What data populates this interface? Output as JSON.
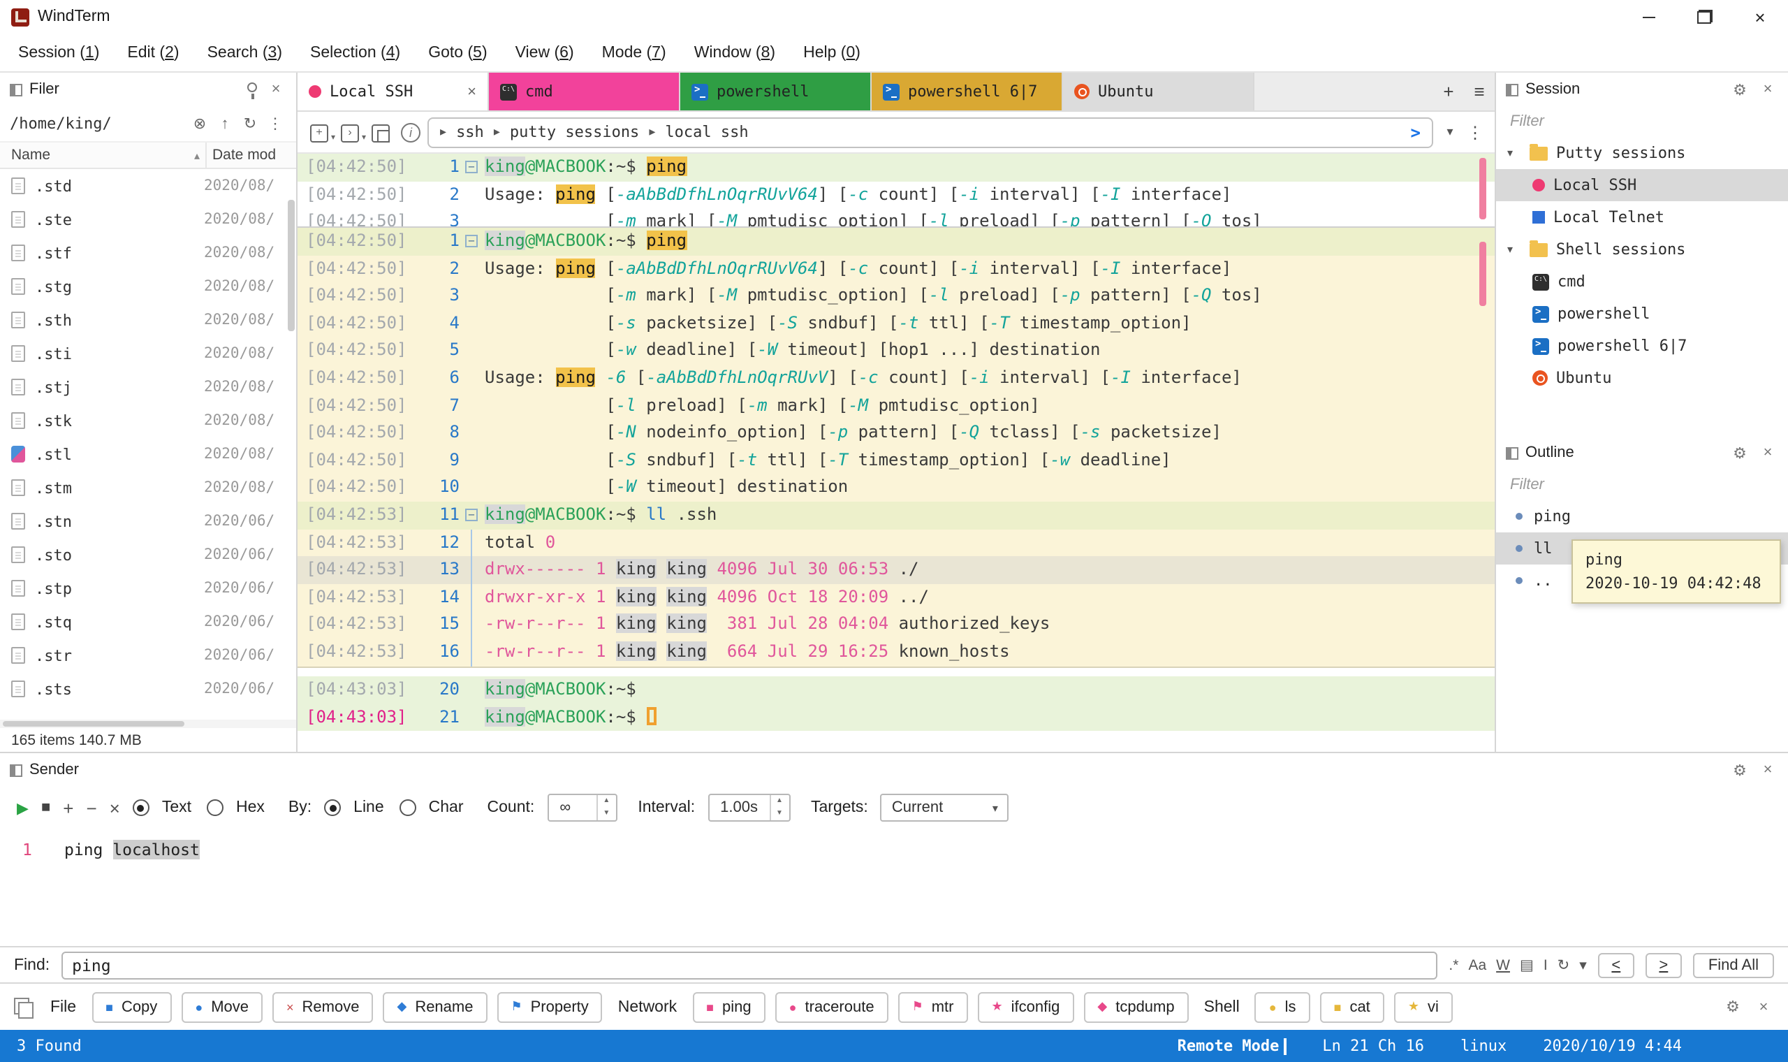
{
  "window": {
    "title": "WindTerm"
  },
  "menu": [
    "Session (1)",
    "Edit (2)",
    "Search (3)",
    "Selection (4)",
    "Goto (5)",
    "View (6)",
    "Mode (7)",
    "Window (8)",
    "Help (0)"
  ],
  "icons": {
    "play": "▶",
    "stop": "■",
    "plus": "+",
    "minus": "−",
    "cross": "×",
    "up_arrow": "▲",
    "down_arrow": "▼",
    "caret_down": "▾",
    "breadcrumb_arrow": "▸",
    "more_vertical": "⋮",
    "menu": "≡",
    "gear": "⚙",
    "sort_asc": "▴",
    "send_arrow": ">",
    "refresh": "↻",
    "clear": "⊗",
    "up_dir": "↑",
    "square": "■",
    "circle": "●",
    "diamond": "◆",
    "flag": "⚑",
    "star": "★"
  },
  "filer": {
    "title": "Filer",
    "path": "/home/king/",
    "name_column": "Name",
    "date_column": "Date mod",
    "files": [
      {
        "name": ".std",
        "date": "2020/08/"
      },
      {
        "name": ".ste",
        "date": "2020/08/"
      },
      {
        "name": ".stf",
        "date": "2020/08/"
      },
      {
        "name": ".stg",
        "date": "2020/08/"
      },
      {
        "name": ".sth",
        "date": "2020/08/"
      },
      {
        "name": ".sti",
        "date": "2020/08/"
      },
      {
        "name": ".stj",
        "date": "2020/08/"
      },
      {
        "name": ".stk",
        "date": "2020/08/"
      },
      {
        "name": ".stl",
        "date": "2020/08/",
        "special": true
      },
      {
        "name": ".stm",
        "date": "2020/08/"
      },
      {
        "name": ".stn",
        "date": "2020/06/"
      },
      {
        "name": ".sto",
        "date": "2020/06/"
      },
      {
        "name": ".stp",
        "date": "2020/06/"
      },
      {
        "name": ".stq",
        "date": "2020/06/"
      },
      {
        "name": ".str",
        "date": "2020/06/"
      },
      {
        "name": ".sts",
        "date": "2020/06/"
      }
    ],
    "status": "165 items 140.7 MB"
  },
  "tabs": [
    {
      "label": "Local SSH",
      "icon": "ssh",
      "active": true
    },
    {
      "label": "cmd",
      "icon": "cmd",
      "color": "pink"
    },
    {
      "label": "powershell",
      "icon": "powershell",
      "color": "green"
    },
    {
      "label": "powershell 6|7",
      "icon": "powershell",
      "color": "yellow"
    },
    {
      "label": "Ubuntu",
      "icon": "ubuntu",
      "color": "grey"
    }
  ],
  "address": {
    "crumbs": [
      "ssh",
      "putty sessions",
      "local ssh"
    ]
  },
  "terminal": {
    "buffer": [
      {
        "ts": "[04:42:50]",
        "n": "1",
        "fold": true,
        "cmd": true,
        "s": [
          [
            "king",
            "kg"
          ],
          [
            "@MACBOOK",
            "g"
          ],
          [
            ":~$ ",
            "d"
          ],
          [
            "ping",
            "m"
          ]
        ]
      },
      {
        "ts": "[04:42:50]",
        "n": "2",
        "s": [
          [
            "Usage: ",
            "d"
          ],
          [
            "ping",
            "m"
          ],
          [
            " [",
            "d"
          ],
          [
            "-aAbBdDfhLnOqrRUvV64",
            "o"
          ],
          [
            "] [",
            "d"
          ],
          [
            "-c",
            "o"
          ],
          [
            " count] [",
            "d"
          ],
          [
            "-i",
            "o"
          ],
          [
            " interval] [",
            "d"
          ],
          [
            "-I",
            "o"
          ],
          [
            " interface]",
            "d"
          ]
        ]
      },
      {
        "ts": "[04:42:50]",
        "n": "3",
        "s": [
          [
            "            [",
            "d"
          ],
          [
            "-m",
            "o"
          ],
          [
            " mark] [",
            "d"
          ],
          [
            "-M",
            "o"
          ],
          [
            " pmtudisc_option] [",
            "d"
          ],
          [
            "-l",
            "o"
          ],
          [
            " preload] [",
            "d"
          ],
          [
            "-p",
            "o"
          ],
          [
            " pattern] [",
            "d"
          ],
          [
            "-Q",
            "o"
          ],
          [
            " tos]",
            "d"
          ]
        ]
      },
      {
        "ts": "[04:42:50]",
        "n": "4",
        "s": [
          [
            "            [",
            "d"
          ],
          [
            "-s",
            "o"
          ],
          [
            " packetsize] [",
            "d"
          ],
          [
            "-S",
            "o"
          ],
          [
            " sndbuf] [",
            "d"
          ],
          [
            "-t",
            "o"
          ],
          [
            " ttl] [",
            "d"
          ],
          [
            "-T",
            "o"
          ],
          [
            " timestamp_option]",
            "d"
          ]
        ]
      },
      {
        "ts": "[04:42:50]",
        "n": "5",
        "s": [
          [
            "            [",
            "d"
          ],
          [
            "-w",
            "o"
          ],
          [
            " deadline] [",
            "d"
          ],
          [
            "-W",
            "o"
          ],
          [
            " timeout] [hop1 ...] destination",
            "d"
          ]
        ]
      },
      {
        "ts": "[04:42:50]",
        "n": "6",
        "s": [
          [
            "Usage: ",
            "d"
          ],
          [
            "ping",
            "m"
          ],
          [
            " ",
            "d"
          ],
          [
            "-6",
            "o"
          ],
          [
            " [",
            "d"
          ],
          [
            "-aAbBdDfhLnOqrRUvV",
            "o"
          ],
          [
            "] [",
            "d"
          ],
          [
            "-c",
            "o"
          ],
          [
            " count] [",
            "d"
          ],
          [
            "-i",
            "o"
          ],
          [
            " interval] [",
            "d"
          ],
          [
            "-I",
            "o"
          ],
          [
            " interface]",
            "d"
          ]
        ]
      },
      {
        "ts": "[04:42:50]",
        "n": "7",
        "s": [
          [
            "            [",
            "d"
          ],
          [
            "-l",
            "o"
          ],
          [
            " preload] [",
            "d"
          ],
          [
            "-m",
            "o"
          ],
          [
            " mark] [",
            "d"
          ],
          [
            "-M",
            "o"
          ],
          [
            " pmtudisc_option]",
            "d"
          ]
        ]
      },
      {
        "ts": "[04:42:50]",
        "n": "8",
        "s": [
          [
            "            [",
            "d"
          ],
          [
            "-N",
            "o"
          ],
          [
            " nodeinfo_option] [",
            "d"
          ],
          [
            "-p",
            "o"
          ],
          [
            " pattern] [",
            "d"
          ],
          [
            "-Q",
            "o"
          ],
          [
            " tclass] [",
            "d"
          ],
          [
            "-s",
            "o"
          ],
          [
            " packetsize]",
            "d"
          ]
        ]
      },
      {
        "ts": "[04:42:50]",
        "n": "9",
        "s": [
          [
            "            [",
            "d"
          ],
          [
            "-S",
            "o"
          ],
          [
            " sndbuf] [",
            "d"
          ],
          [
            "-t",
            "o"
          ],
          [
            " ttl] [",
            "d"
          ],
          [
            "-T",
            "o"
          ],
          [
            " timestamp_option] [",
            "d"
          ],
          [
            "-w",
            "o"
          ],
          [
            " deadline]",
            "d"
          ]
        ]
      },
      {
        "ts": "[04:42:50]",
        "n": "10",
        "s": [
          [
            "            [",
            "d"
          ],
          [
            "-W",
            "o"
          ],
          [
            " timeout] destination",
            "d"
          ]
        ]
      },
      {
        "ts": "[04:42:53]",
        "n": "11",
        "fold": true,
        "cmd": true,
        "s": [
          [
            "king",
            "kg"
          ],
          [
            "@MACBOOK",
            "g"
          ],
          [
            ":~$ ",
            "d"
          ],
          [
            "ll",
            "b"
          ],
          [
            " .ssh",
            "d"
          ]
        ]
      },
      {
        "ts": "[04:42:53]",
        "n": "12",
        "gd": true,
        "s": [
          [
            "total ",
            "d"
          ],
          [
            "0",
            "p"
          ]
        ]
      },
      {
        "ts": "[04:42:53]",
        "n": "13",
        "gd": true,
        "hl": true,
        "s": [
          [
            "drwx------",
            "p"
          ],
          [
            " ",
            "d"
          ],
          [
            "1",
            "p"
          ],
          [
            " ",
            "d"
          ],
          [
            "king",
            "kd"
          ],
          [
            " ",
            "d"
          ],
          [
            "king",
            "kd"
          ],
          [
            " ",
            "d"
          ],
          [
            "4096",
            "p"
          ],
          [
            " ",
            "d"
          ],
          [
            "Jul 30 06:53",
            "p"
          ],
          [
            " ./",
            "d"
          ]
        ]
      },
      {
        "ts": "[04:42:53]",
        "n": "14",
        "gd": true,
        "s": [
          [
            "drwxr-xr-x",
            "p"
          ],
          [
            " ",
            "d"
          ],
          [
            "1",
            "p"
          ],
          [
            " ",
            "d"
          ],
          [
            "king",
            "kd"
          ],
          [
            " ",
            "d"
          ],
          [
            "king",
            "kd"
          ],
          [
            " ",
            "d"
          ],
          [
            "4096",
            "p"
          ],
          [
            " ",
            "d"
          ],
          [
            "Oct 18 20:09",
            "p"
          ],
          [
            " ../",
            "d"
          ]
        ]
      },
      {
        "ts": "[04:42:53]",
        "n": "15",
        "gd": true,
        "s": [
          [
            "-rw-r--r--",
            "p"
          ],
          [
            " ",
            "d"
          ],
          [
            "1",
            "p"
          ],
          [
            " ",
            "d"
          ],
          [
            "king",
            "kd"
          ],
          [
            " ",
            "d"
          ],
          [
            "king",
            "kd"
          ],
          [
            "  ",
            "d"
          ],
          [
            "381",
            "p"
          ],
          [
            " ",
            "d"
          ],
          [
            "Jul 28 04:04",
            "p"
          ],
          [
            " authorized_keys",
            "d"
          ]
        ]
      },
      {
        "ts": "[04:42:53]",
        "n": "16",
        "gd": true,
        "s": [
          [
            "-rw-r--r--",
            "p"
          ],
          [
            " ",
            "d"
          ],
          [
            "1",
            "p"
          ],
          [
            " ",
            "d"
          ],
          [
            "king",
            "kd"
          ],
          [
            " ",
            "d"
          ],
          [
            "king",
            "kd"
          ],
          [
            "  ",
            "d"
          ],
          [
            "664",
            "p"
          ],
          [
            " ",
            "d"
          ],
          [
            "Jul 29 16:25",
            "p"
          ],
          [
            " known_hosts",
            "d"
          ]
        ]
      }
    ],
    "tail": [
      {
        "ts": "[04:43:03]",
        "n": "20",
        "cmd": true,
        "s": [
          [
            "king",
            "kg"
          ],
          [
            "@MACBOOK",
            "g"
          ],
          [
            ":~$",
            "d"
          ]
        ]
      },
      {
        "ts": "[04:43:03]",
        "n": "21",
        "cmd": true,
        "tsm": true,
        "s": [
          [
            "king",
            "kg"
          ],
          [
            "@MACBOOK",
            "g"
          ],
          [
            ":~$ ",
            "d"
          ],
          [
            "",
            "cur"
          ]
        ]
      }
    ]
  },
  "session_panel": {
    "title": "Session",
    "filter_placeholder": "Filter",
    "items": [
      {
        "label": "Putty sessions",
        "icon": "folder",
        "caret": true,
        "level": 0
      },
      {
        "label": "Local SSH",
        "icon": "ssh",
        "level": 1,
        "selected": true
      },
      {
        "label": "Local Telnet",
        "icon": "telnet",
        "level": 1
      },
      {
        "label": "Shell sessions",
        "icon": "folder",
        "caret": true,
        "level": 0
      },
      {
        "label": "cmd",
        "icon": "cmd",
        "level": 1
      },
      {
        "label": "powershell",
        "icon": "powershell",
        "level": 1
      },
      {
        "label": "powershell 6|7",
        "icon": "powershell",
        "level": 1
      },
      {
        "label": "Ubuntu",
        "icon": "ubuntu",
        "level": 1
      }
    ]
  },
  "outline_panel": {
    "title": "Outline",
    "filter_placeholder": "Filter",
    "items": [
      {
        "label": "ping"
      },
      {
        "label": "ll",
        "selected": true
      },
      {
        "label": ".."
      }
    ],
    "tooltip": {
      "command": "ping",
      "timestamp": "2020-10-19 04:42:48"
    }
  },
  "sender": {
    "title": "Sender",
    "text_option": "Text",
    "hex_option": "Hex",
    "by_label": "By:",
    "line_option": "Line",
    "char_option": "Char",
    "count_label": "Count:",
    "count_value": "∞",
    "interval_label": "Interval:",
    "interval_value": "1.00s",
    "targets_label": "Targets:",
    "targets_value": "Current",
    "line_number": "1",
    "command_prefix": "ping ",
    "command_selected": "localhost"
  },
  "find": {
    "label": "Find:",
    "value": "ping",
    "icons": [
      {
        "name": "regex-icon",
        "glyph": ".*"
      },
      {
        "name": "match-case-icon",
        "glyph": "Aa"
      },
      {
        "name": "whole-word-icon",
        "glyph": "W",
        "underline": true
      },
      {
        "name": "in-selection-icon",
        "glyph": "▤"
      },
      {
        "name": "cursor-icon",
        "glyph": "I"
      },
      {
        "name": "wrap-around-icon",
        "glyph": "↻"
      },
      {
        "name": "find-options-dropdown-icon",
        "glyph": "▾"
      }
    ],
    "prev_label": "<",
    "next_label": ">",
    "find_all_label": "Find All"
  },
  "toolbar": {
    "groups": [
      {
        "label": "File",
        "buttons": [
          {
            "label": "Copy",
            "icon": "square",
            "color": "#2e7cd6"
          },
          {
            "label": "Move",
            "icon": "circle",
            "color": "#2e7cd6"
          },
          {
            "label": "Remove",
            "icon": "cross",
            "color": "#c84a4a"
          },
          {
            "label": "Rename",
            "icon": "diamond",
            "color": "#2e7cd6"
          },
          {
            "label": "Property",
            "icon": "flag",
            "color": "#2e7cd6"
          }
        ]
      },
      {
        "label": "Network",
        "buttons": [
          {
            "label": "ping",
            "icon": "square",
            "color": "#e8488a"
          },
          {
            "label": "traceroute",
            "icon": "circle",
            "color": "#e8488a"
          },
          {
            "label": "mtr",
            "icon": "flag",
            "color": "#e8488a"
          },
          {
            "label": "ifconfig",
            "icon": "star",
            "color": "#e8488a"
          },
          {
            "label": "tcpdump",
            "icon": "diamond",
            "color": "#e8488a"
          }
        ]
      },
      {
        "label": "Shell",
        "buttons": [
          {
            "label": "ls",
            "icon": "circle",
            "color": "#e5b73b"
          },
          {
            "label": "cat",
            "icon": "square",
            "color": "#e5b73b"
          },
          {
            "label": "vi",
            "icon": "star",
            "color": "#e5b73b"
          }
        ]
      }
    ]
  },
  "statusbar": {
    "found": "3 Found",
    "mode": "Remote Mode",
    "cursor_position": "Ln 21 Ch 16",
    "platform": "linux",
    "datetime": "2020/10/19 4:44"
  }
}
